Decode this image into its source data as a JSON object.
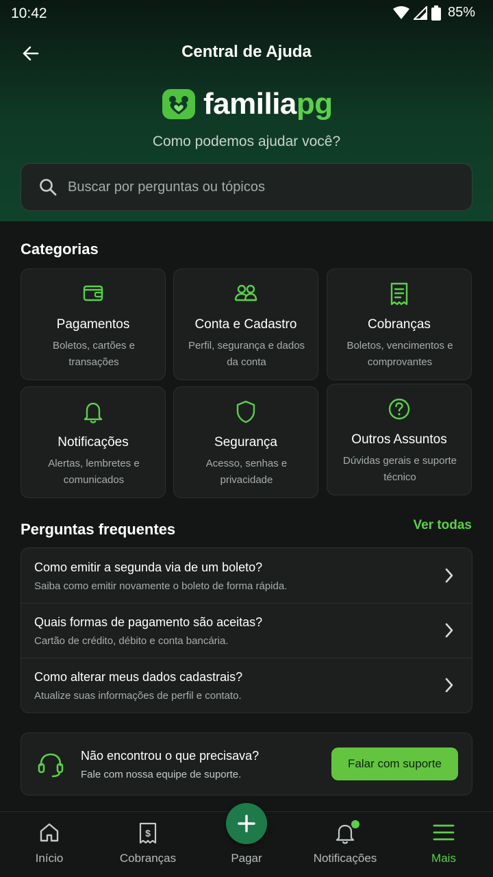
{
  "status_bar": {
    "time": "10:42",
    "battery": "85%"
  },
  "header": {
    "title": "Central de Ajuda"
  },
  "brand": {
    "part1": "familia",
    "part2": "pg"
  },
  "hero": {
    "subtitle": "Como podemos ajudar você?"
  },
  "search": {
    "placeholder": "Buscar por perguntas ou tópicos"
  },
  "categories": {
    "title": "Categorias",
    "items": [
      {
        "icon": "wallet-icon",
        "title": "Pagamentos",
        "desc": "Boletos, cartões e transações"
      },
      {
        "icon": "users-icon",
        "title": "Conta e Cadastro",
        "desc": "Perfil, segurança e dados da conta"
      },
      {
        "icon": "receipt-icon",
        "title": "Cobranças",
        "desc": "Boletos, vencimentos e comprovantes"
      },
      {
        "icon": "bell-icon",
        "title": "Notificações",
        "desc": "Alertas, lembretes e comunicados"
      },
      {
        "icon": "shield-icon",
        "title": "Segurança",
        "desc": "Acesso, senhas e privacidade"
      },
      {
        "icon": "help-circle-icon",
        "title": "Outros Assuntos",
        "desc": "Dúvidas gerais e suporte técnico"
      }
    ]
  },
  "faq": {
    "title": "Perguntas frequentes",
    "see_all": "Ver todas",
    "items": [
      {
        "q": "Como emitir a segunda via de um boleto?",
        "a": "Saiba como emitir novamente o boleto de forma rápida."
      },
      {
        "q": "Quais formas de pagamento são aceitas?",
        "a": "Cartão de crédito, débito e conta bancária."
      },
      {
        "q": "Como alterar meus dados cadastrais?",
        "a": "Atualize suas informações de perfil e contato."
      }
    ]
  },
  "support": {
    "title": "Não encontrou o que precisava?",
    "desc": "Fale com nossa equipe de suporte.",
    "button": "Falar com suporte"
  },
  "nav": {
    "items": [
      {
        "label": "Início",
        "icon": "home-icon"
      },
      {
        "label": "Cobranças",
        "icon": "invoice-icon"
      },
      {
        "label": "Pagar",
        "icon": "plus-icon"
      },
      {
        "label": "Notificações",
        "icon": "bell-icon"
      },
      {
        "label": "Mais",
        "icon": "menu-icon",
        "active": true
      }
    ]
  },
  "colors": {
    "accent": "#5bd04a",
    "hero_bg": "#0f3a26",
    "fab_bg": "#1f7a4a",
    "support_button": "#63c53f"
  }
}
